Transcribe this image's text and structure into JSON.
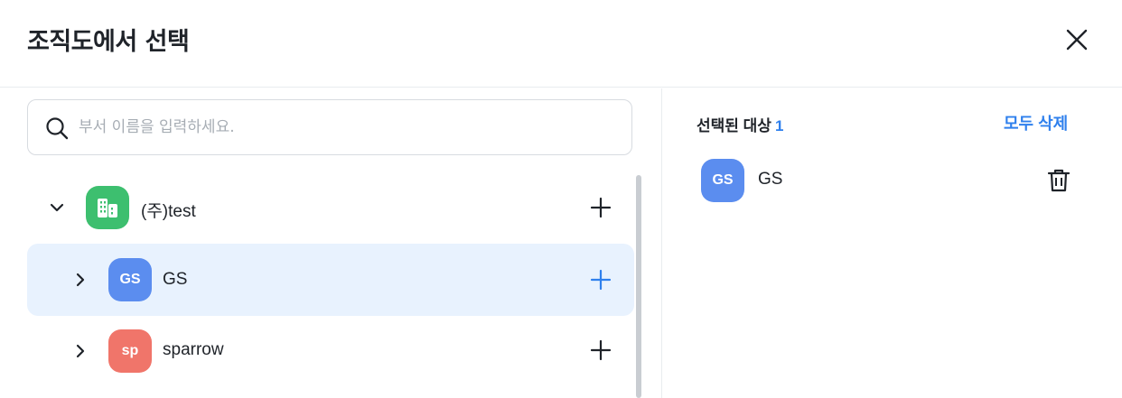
{
  "dialog": {
    "title": "조직도에서 선택",
    "close_icon": "close-icon"
  },
  "search": {
    "placeholder": "부서 이름을 입력하세요.",
    "value": "",
    "icon": "search-icon"
  },
  "tree": {
    "items": [
      {
        "label": "(주)test",
        "avatar_text": "",
        "avatar_icon": "building-icon",
        "avatar_color": "#3dbf6f",
        "expanded": true,
        "selected": false
      },
      {
        "label": "GS",
        "avatar_text": "GS",
        "avatar_color": "#5b8def",
        "expanded": false,
        "selected": true
      },
      {
        "label": "sparrow",
        "avatar_text": "sp",
        "avatar_color": "#f0756a",
        "expanded": false,
        "selected": false
      }
    ]
  },
  "selection": {
    "title": "선택된 대상",
    "count": "1",
    "clear_all_label": "모두 삭제",
    "items": [
      {
        "label": "GS",
        "avatar_text": "GS",
        "avatar_color": "#5b8def",
        "remove_icon": "trash-icon"
      }
    ]
  },
  "colors": {
    "accent": "#2f80ed",
    "selected_row_bg": "#e8f2fe"
  }
}
